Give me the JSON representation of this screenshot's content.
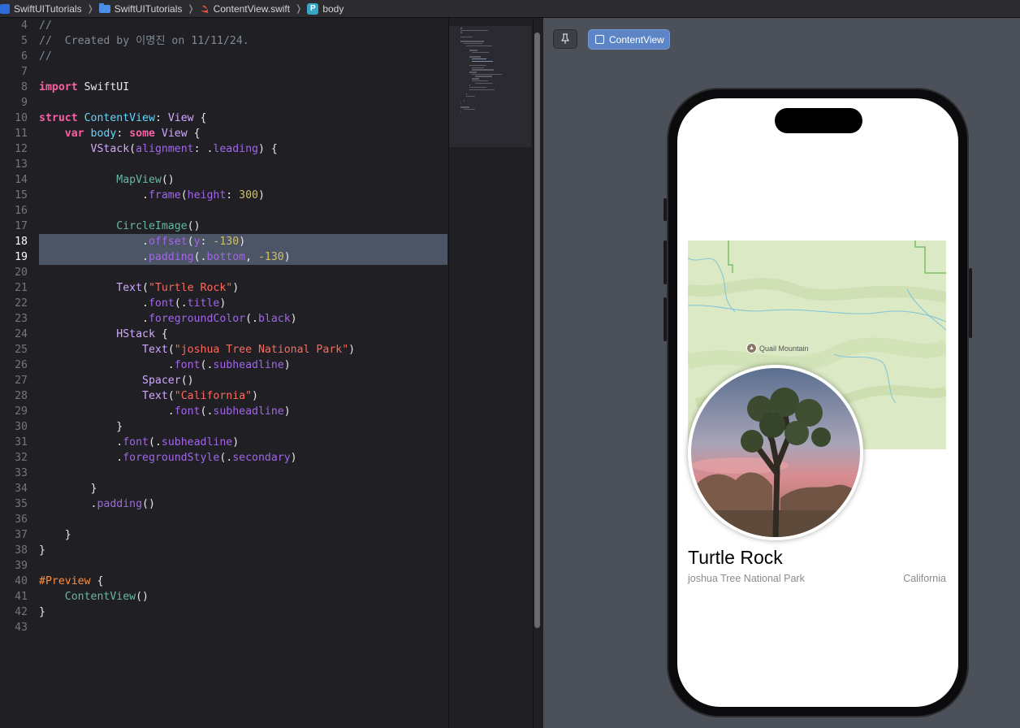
{
  "breadcrumb": {
    "project": "SwiftUITutorials",
    "folder": "SwiftUITutorials",
    "file": "ContentView.swift",
    "symbol_badge": "P",
    "symbol": "body"
  },
  "editor": {
    "current_lines": [
      18,
      19
    ],
    "lines": [
      {
        "n": "4",
        "tokens": [
          {
            "t": "//",
            "c": "cm"
          }
        ]
      },
      {
        "n": "5",
        "tokens": [
          {
            "t": "//  Created by 이명진 on 11/11/24.",
            "c": "cm"
          }
        ]
      },
      {
        "n": "6",
        "tokens": [
          {
            "t": "//",
            "c": "cm"
          }
        ]
      },
      {
        "n": "7",
        "tokens": []
      },
      {
        "n": "8",
        "tokens": [
          {
            "t": "import",
            "c": "kw"
          },
          {
            "t": " SwiftUI",
            "c": "pl"
          }
        ]
      },
      {
        "n": "9",
        "tokens": []
      },
      {
        "n": "10",
        "tokens": [
          {
            "t": "struct",
            "c": "kw"
          },
          {
            "t": " ",
            "c": "pl"
          },
          {
            "t": "ContentView",
            "c": "tyc"
          },
          {
            "t": ": ",
            "c": "pl"
          },
          {
            "t": "View",
            "c": "ty"
          },
          {
            "t": " {",
            "c": "pl"
          }
        ]
      },
      {
        "n": "11",
        "tokens": [
          {
            "t": "    ",
            "c": "pl"
          },
          {
            "t": "var",
            "c": "kw"
          },
          {
            "t": " ",
            "c": "pl"
          },
          {
            "t": "body",
            "c": "tyc"
          },
          {
            "t": ": ",
            "c": "pl"
          },
          {
            "t": "some",
            "c": "kw"
          },
          {
            "t": " ",
            "c": "pl"
          },
          {
            "t": "View",
            "c": "ty"
          },
          {
            "t": " {",
            "c": "pl"
          }
        ]
      },
      {
        "n": "12",
        "tokens": [
          {
            "t": "        ",
            "c": "pl"
          },
          {
            "t": "VStack",
            "c": "ty"
          },
          {
            "t": "(",
            "c": "pl"
          },
          {
            "t": "alignment",
            "c": "mem"
          },
          {
            "t": ": .",
            "c": "pl"
          },
          {
            "t": "leading",
            "c": "mem"
          },
          {
            "t": ") {",
            "c": "pl"
          }
        ]
      },
      {
        "n": "13",
        "tokens": []
      },
      {
        "n": "14",
        "tokens": [
          {
            "t": "            ",
            "c": "pl"
          },
          {
            "t": "MapView",
            "c": "fnp"
          },
          {
            "t": "()",
            "c": "pl"
          }
        ]
      },
      {
        "n": "15",
        "tokens": [
          {
            "t": "                .",
            "c": "pl"
          },
          {
            "t": "frame",
            "c": "mem"
          },
          {
            "t": "(",
            "c": "pl"
          },
          {
            "t": "height",
            "c": "mem"
          },
          {
            "t": ": ",
            "c": "pl"
          },
          {
            "t": "300",
            "c": "num"
          },
          {
            "t": ")",
            "c": "pl"
          }
        ]
      },
      {
        "n": "16",
        "tokens": []
      },
      {
        "n": "17",
        "tokens": [
          {
            "t": "            ",
            "c": "pl"
          },
          {
            "t": "CircleImage",
            "c": "fnp"
          },
          {
            "t": "()",
            "c": "pl"
          }
        ]
      },
      {
        "n": "18",
        "tokens": [
          {
            "t": "                .",
            "c": "pl"
          },
          {
            "t": "offset",
            "c": "mem"
          },
          {
            "t": "(",
            "c": "pl"
          },
          {
            "t": "y",
            "c": "mem"
          },
          {
            "t": ": ",
            "c": "pl"
          },
          {
            "t": "-130",
            "c": "num"
          },
          {
            "t": ")",
            "c": "pl"
          }
        ]
      },
      {
        "n": "19",
        "tokens": [
          {
            "t": "                .",
            "c": "pl"
          },
          {
            "t": "padding",
            "c": "mem"
          },
          {
            "t": "(.",
            "c": "pl"
          },
          {
            "t": "bottom",
            "c": "mem"
          },
          {
            "t": ", ",
            "c": "pl"
          },
          {
            "t": "-130",
            "c": "num"
          },
          {
            "t": ")",
            "c": "pl"
          }
        ]
      },
      {
        "n": "20",
        "tokens": []
      },
      {
        "n": "21",
        "tokens": [
          {
            "t": "            ",
            "c": "pl"
          },
          {
            "t": "Text",
            "c": "ty"
          },
          {
            "t": "(",
            "c": "pl"
          },
          {
            "t": "\"Turtle Rock\"",
            "c": "str"
          },
          {
            "t": ")",
            "c": "pl"
          }
        ]
      },
      {
        "n": "22",
        "tokens": [
          {
            "t": "                .",
            "c": "pl"
          },
          {
            "t": "font",
            "c": "mem"
          },
          {
            "t": "(.",
            "c": "pl"
          },
          {
            "t": "title",
            "c": "mem"
          },
          {
            "t": ")",
            "c": "pl"
          }
        ]
      },
      {
        "n": "23",
        "tokens": [
          {
            "t": "                .",
            "c": "pl"
          },
          {
            "t": "foregroundColor",
            "c": "mem"
          },
          {
            "t": "(.",
            "c": "pl"
          },
          {
            "t": "black",
            "c": "mem"
          },
          {
            "t": ")",
            "c": "pl"
          }
        ]
      },
      {
        "n": "24",
        "tokens": [
          {
            "t": "            ",
            "c": "pl"
          },
          {
            "t": "HStack",
            "c": "ty"
          },
          {
            "t": " {",
            "c": "pl"
          }
        ]
      },
      {
        "n": "25",
        "tokens": [
          {
            "t": "                ",
            "c": "pl"
          },
          {
            "t": "Text",
            "c": "ty"
          },
          {
            "t": "(",
            "c": "pl"
          },
          {
            "t": "\"joshua Tree National Park\"",
            "c": "str"
          },
          {
            "t": ")",
            "c": "pl"
          }
        ]
      },
      {
        "n": "26",
        "tokens": [
          {
            "t": "                    .",
            "c": "pl"
          },
          {
            "t": "font",
            "c": "mem"
          },
          {
            "t": "(.",
            "c": "pl"
          },
          {
            "t": "subheadline",
            "c": "mem"
          },
          {
            "t": ")",
            "c": "pl"
          }
        ]
      },
      {
        "n": "27",
        "tokens": [
          {
            "t": "                ",
            "c": "pl"
          },
          {
            "t": "Spacer",
            "c": "ty"
          },
          {
            "t": "()",
            "c": "pl"
          }
        ]
      },
      {
        "n": "28",
        "tokens": [
          {
            "t": "                ",
            "c": "pl"
          },
          {
            "t": "Text",
            "c": "ty"
          },
          {
            "t": "(",
            "c": "pl"
          },
          {
            "t": "\"California\"",
            "c": "str"
          },
          {
            "t": ")",
            "c": "pl"
          }
        ]
      },
      {
        "n": "29",
        "tokens": [
          {
            "t": "                    .",
            "c": "pl"
          },
          {
            "t": "font",
            "c": "mem"
          },
          {
            "t": "(.",
            "c": "pl"
          },
          {
            "t": "subheadline",
            "c": "mem"
          },
          {
            "t": ")",
            "c": "pl"
          }
        ]
      },
      {
        "n": "30",
        "tokens": [
          {
            "t": "            }",
            "c": "pl"
          }
        ]
      },
      {
        "n": "31",
        "tokens": [
          {
            "t": "            .",
            "c": "pl"
          },
          {
            "t": "font",
            "c": "mem"
          },
          {
            "t": "(.",
            "c": "pl"
          },
          {
            "t": "subheadline",
            "c": "mem"
          },
          {
            "t": ")",
            "c": "pl"
          }
        ]
      },
      {
        "n": "32",
        "tokens": [
          {
            "t": "            .",
            "c": "pl"
          },
          {
            "t": "foregroundStyle",
            "c": "mem"
          },
          {
            "t": "(.",
            "c": "pl"
          },
          {
            "t": "secondary",
            "c": "mem"
          },
          {
            "t": ")",
            "c": "pl"
          }
        ]
      },
      {
        "n": "33",
        "tokens": []
      },
      {
        "n": "34",
        "tokens": [
          {
            "t": "        }",
            "c": "pl"
          }
        ]
      },
      {
        "n": "35",
        "tokens": [
          {
            "t": "        .",
            "c": "pl"
          },
          {
            "t": "padding",
            "c": "mem"
          },
          {
            "t": "()",
            "c": "pl"
          }
        ]
      },
      {
        "n": "36",
        "tokens": []
      },
      {
        "n": "37",
        "tokens": [
          {
            "t": "    }",
            "c": "pl"
          }
        ]
      },
      {
        "n": "38",
        "tokens": [
          {
            "t": "}",
            "c": "pl"
          }
        ]
      },
      {
        "n": "39",
        "tokens": []
      },
      {
        "n": "40",
        "tokens": [
          {
            "t": "#Preview",
            "c": "macro"
          },
          {
            "t": " {",
            "c": "pl"
          }
        ]
      },
      {
        "n": "41",
        "tokens": [
          {
            "t": "    ",
            "c": "pl"
          },
          {
            "t": "ContentView",
            "c": "fnp"
          },
          {
            "t": "()",
            "c": "pl"
          }
        ]
      },
      {
        "n": "42",
        "tokens": [
          {
            "t": "}",
            "c": "pl"
          }
        ]
      },
      {
        "n": "43",
        "tokens": []
      }
    ]
  },
  "preview": {
    "pin_icon": "pin-icon",
    "selector_label": "ContentView",
    "map_label": "Quail Mountain",
    "title": "Turtle Rock",
    "park": "joshua Tree National Park",
    "state": "California"
  },
  "colors": {
    "keyword": "#fc5fa3",
    "type": "#d0a8ff",
    "string": "#fc6a5d",
    "number": "#d0bf69",
    "comment": "#7f8c98",
    "selection": "#4b5566",
    "accent": "#5d84c5"
  }
}
